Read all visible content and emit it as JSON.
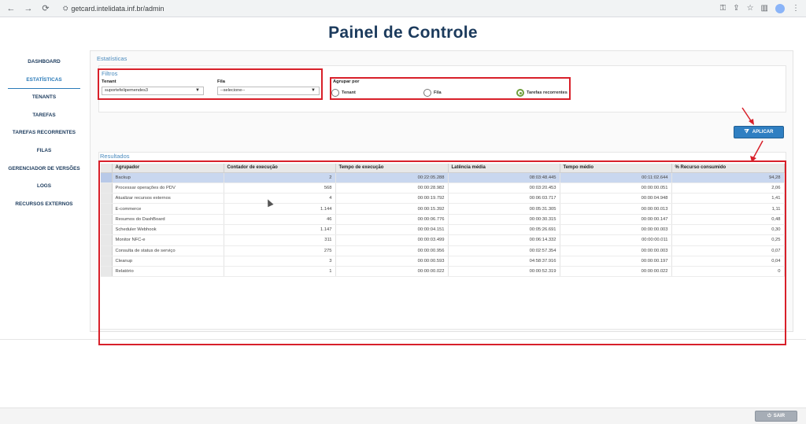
{
  "browser": {
    "url": "getcard.intelidata.inf.br/admin"
  },
  "page": {
    "title": "Painel de Controle"
  },
  "sidebar": {
    "items": [
      {
        "label": "DASHBOARD",
        "active": false
      },
      {
        "label": "ESTATÍSTICAS",
        "active": true
      },
      {
        "label": "TENANTS",
        "active": false
      },
      {
        "label": "TAREFAS",
        "active": false
      },
      {
        "label": "TAREFAS RECORRENTES",
        "active": false
      },
      {
        "label": "FILAS",
        "active": false
      },
      {
        "label": "GERENCIADOR DE VERSÕES",
        "active": false
      },
      {
        "label": "LOGS",
        "active": false
      },
      {
        "label": "RECURSOS EXTERNOS",
        "active": false
      }
    ]
  },
  "main": {
    "section_title": "Estatísticas",
    "filters": {
      "title": "Filtros",
      "tenant_label": "Tenant",
      "tenant_value": "suportefelipemendes3",
      "queue_label": "Fila",
      "queue_value": "--selecione--"
    },
    "group_by": {
      "label": "Agrupar por",
      "options": [
        {
          "label": "Tenant",
          "checked": false
        },
        {
          "label": "Fila",
          "checked": false
        },
        {
          "label": "Tarefas recorrentes",
          "checked": true
        }
      ]
    },
    "apply_label": "APLICAR",
    "results": {
      "title": "Resultados",
      "columns": [
        "Agrupador",
        "Contador de execução",
        "Tempo de execução",
        "Latência média",
        "Tempo médio",
        "% Recurso consumido"
      ],
      "rows": [
        [
          "Backup",
          "2",
          "00:22:05.288",
          "08:03:48.445",
          "00:11:02.644",
          "94,28"
        ],
        [
          "Processar operações do PDV",
          "568",
          "00:00:28.982",
          "00:03:20.453",
          "00:00:00.051",
          "2,06"
        ],
        [
          "Atualizar recursos externos",
          "4",
          "00:00:19.792",
          "00:06:03.717",
          "00:00:04.948",
          "1,41"
        ],
        [
          "E-commerce",
          "1.144",
          "00:00:15.392",
          "00:05:31.305",
          "00:00:00.013",
          "1,11"
        ],
        [
          "Resumos do DashBoard",
          "46",
          "00:00:06.776",
          "00:00:30.315",
          "00:00:00.147",
          "0,48"
        ],
        [
          "Scheduler Webhook",
          "1.147",
          "00:00:04.151",
          "00:05:26.691",
          "00:00:00.003",
          "0,30"
        ],
        [
          "Monitor NFC-e",
          "311",
          "00:00:03.499",
          "00:06:14.332",
          "00:00:00.011",
          "0,25"
        ],
        [
          "Consulta de status de serviço",
          "275",
          "00:00:00.956",
          "00:02:57.354",
          "00:00:00.003",
          "0,07"
        ],
        [
          "Cleanup",
          "3",
          "00:00:00.593",
          "04:58:37.916",
          "00:00:00.197",
          "0,04"
        ],
        [
          "Relatório",
          "1",
          "00:00:00.022",
          "00:00:52.319",
          "00:00:00.022",
          "0"
        ]
      ],
      "selected_row": 0
    }
  },
  "footer": {
    "logout_label": "SAIR"
  },
  "colors": {
    "accent": "#2f7fc2",
    "title": "#1b3a5c",
    "highlight": "#d8202a",
    "selected_row": "#c9d7ef",
    "radio_checked": "#6e9e3b"
  }
}
